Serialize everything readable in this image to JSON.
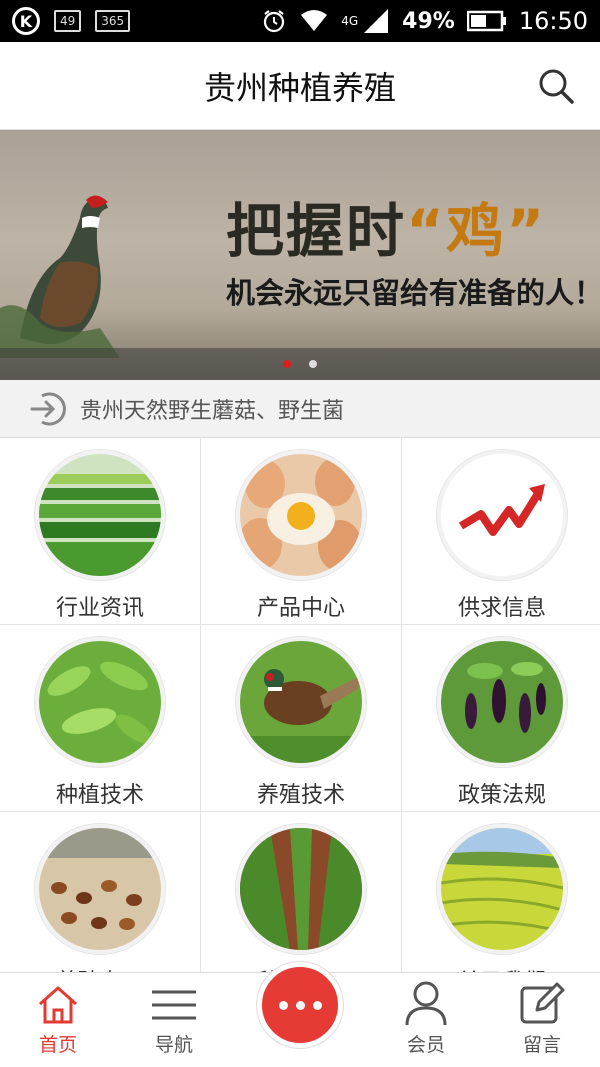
{
  "status_bar": {
    "badge_1": "49",
    "badge_2": "365",
    "network": "4G",
    "battery": "49%",
    "time": "16:50"
  },
  "header": {
    "title": "贵州种植养殖"
  },
  "banner": {
    "line1_pre": "把握时",
    "line1_highlight": "“鸡”",
    "line2": "机会永远只留给有准备的人！",
    "slide_count": 2,
    "active_slide": 1
  },
  "notice": {
    "text": "贵州天然野生蘑菇、野生菌"
  },
  "grid": {
    "items": [
      {
        "label": "行业资讯",
        "icon": "field-rows-icon"
      },
      {
        "label": "产品中心",
        "icon": "eggs-icon"
      },
      {
        "label": "供求信息",
        "icon": "trend-arrow-icon"
      },
      {
        "label": "种植技术",
        "icon": "leafy-plant-icon"
      },
      {
        "label": "养殖技术",
        "icon": "pheasant-icon"
      },
      {
        "label": "政策法规",
        "icon": "eggplant-icon"
      },
      {
        "label": "养殖专一",
        "icon": "chicken-flock-icon"
      },
      {
        "label": "种植专一",
        "icon": "crop-rows-icon"
      },
      {
        "label": "关于我们",
        "icon": "terraces-icon"
      }
    ]
  },
  "tabbar": {
    "home": "首页",
    "nav": "导航",
    "member": "会员",
    "message": "留言",
    "active": "home"
  },
  "colors": {
    "accent": "#e23b32",
    "trend_red": "#d62727",
    "text": "#333333"
  }
}
